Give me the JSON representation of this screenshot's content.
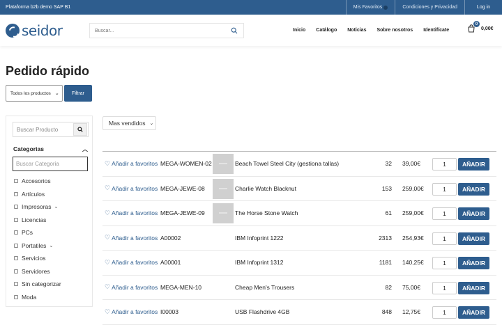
{
  "topbar": {
    "company": "Plataforma b2b demo SAP B1",
    "favorites": "Mis Favoritos",
    "terms": "Condiciones y Privacidad",
    "login": "Log in"
  },
  "brand": {
    "logo_text": "seidor"
  },
  "search": {
    "placeholder": "Buscar..."
  },
  "nav": [
    "Inicio",
    "Catálogo",
    "Noticias",
    "Sobre nosotros",
    "Identifícate"
  ],
  "cart": {
    "count": "0",
    "total": "0,00€"
  },
  "page": {
    "title": "Pedido rápido",
    "filter_select": "Todos los productos",
    "filter_button": "Filtrar"
  },
  "sidebar": {
    "search_placeholder": "Buscar Producto",
    "categories_title": "Categorias",
    "category_search_placeholder": "Buscar Categoria",
    "categories": [
      {
        "label": "Accesorios",
        "has_children": false
      },
      {
        "label": "Artículos",
        "has_children": false
      },
      {
        "label": "Impresoras",
        "has_children": true
      },
      {
        "label": "Licencias",
        "has_children": false
      },
      {
        "label": "PCs",
        "has_children": false
      },
      {
        "label": "Portatiles",
        "has_children": true
      },
      {
        "label": "Servicios",
        "has_children": false
      },
      {
        "label": "Servidores",
        "has_children": false
      },
      {
        "label": "Sin categorizar",
        "has_children": false
      },
      {
        "label": "Moda",
        "has_children": false
      }
    ]
  },
  "sort": {
    "label": "Mas vendidos"
  },
  "products": {
    "favorite_label": "Añadir a favoritos",
    "add_label": "AÑADIR",
    "rows": [
      {
        "sku": "MEGA-WOMEN-02",
        "has_image": true,
        "name": "Beach Towel Steel City (gestiona tallas)",
        "stock": "32",
        "price": "39,00€",
        "qty": "1"
      },
      {
        "sku": "MEGA-JEWE-08",
        "has_image": true,
        "name": "Charlie Watch Blacknut",
        "stock": "153",
        "price": "259,00€",
        "qty": "1"
      },
      {
        "sku": "MEGA-JEWE-09",
        "has_image": true,
        "name": "The Horse Stone Watch",
        "stock": "61",
        "price": "259,00€",
        "qty": "1"
      },
      {
        "sku": "A00002",
        "has_image": false,
        "name": "IBM Infoprint 1222",
        "stock": "2313",
        "price": "254,93€",
        "qty": "1"
      },
      {
        "sku": "A00001",
        "has_image": false,
        "name": "IBM Infoprint 1312",
        "stock": "1181",
        "price": "140,25€",
        "qty": "1"
      },
      {
        "sku": "MEGA-MEN-10",
        "has_image": false,
        "name": "Cheap Men's Trousers",
        "stock": "82",
        "price": "75,00€",
        "qty": "1"
      },
      {
        "sku": "I00003",
        "has_image": false,
        "name": "USB Flashdrive 4GB",
        "stock": "848",
        "price": "12,75€",
        "qty": "1"
      }
    ]
  }
}
